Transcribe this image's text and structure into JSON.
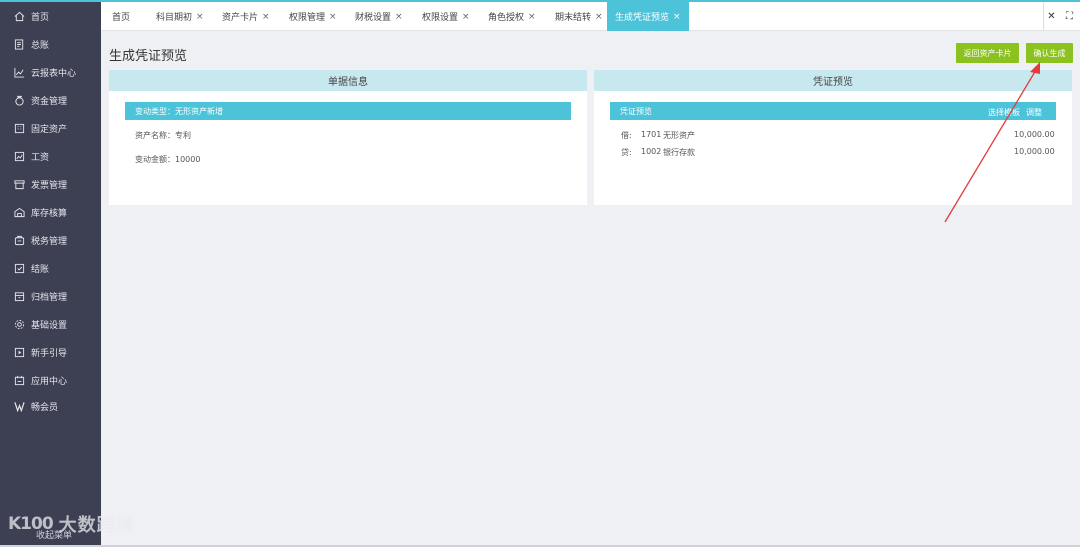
{
  "sidebar": {
    "items": [
      {
        "label": "首页",
        "icon": "home-icon"
      },
      {
        "label": "总账",
        "icon": "ledger-icon"
      },
      {
        "label": "云报表中心",
        "icon": "report-icon"
      },
      {
        "label": "资金管理",
        "icon": "money-bag-icon"
      },
      {
        "label": "固定资产",
        "icon": "building-icon"
      },
      {
        "label": "工资",
        "icon": "payroll-icon"
      },
      {
        "label": "发票管理",
        "icon": "invoice-icon"
      },
      {
        "label": "库存核算",
        "icon": "warehouse-icon"
      },
      {
        "label": "税务管理",
        "icon": "tax-icon"
      },
      {
        "label": "结账",
        "icon": "checkout-icon"
      },
      {
        "label": "归档管理",
        "icon": "archive-icon"
      },
      {
        "label": "基础设置",
        "icon": "gear-icon"
      },
      {
        "label": "新手引导",
        "icon": "play-guide-icon"
      },
      {
        "label": "应用中心",
        "icon": "app-center-icon"
      },
      {
        "label": "畅会员",
        "icon": "vip-icon"
      }
    ],
    "bottom_label": "收起菜单"
  },
  "watermark": {
    "logo": "K100",
    "text": "大数跨境"
  },
  "tabs": [
    {
      "label": "首页",
      "closable": false
    },
    {
      "label": "科目期初",
      "closable": true
    },
    {
      "label": "资产卡片",
      "closable": true
    },
    {
      "label": "权限管理",
      "closable": true
    },
    {
      "label": "财税设置",
      "closable": true
    },
    {
      "label": "权限设置",
      "closable": true
    },
    {
      "label": "角色授权",
      "closable": true
    },
    {
      "label": "期末结转",
      "closable": true
    },
    {
      "label": "生成凭证预览",
      "closable": true,
      "active": true
    }
  ],
  "tab_close_glyph": "×",
  "tabbar_controls": {
    "close_all": "✕",
    "fullscreen": "⛶"
  },
  "page": {
    "title": "生成凭证预览",
    "back_button": "返回资产卡片",
    "confirm_button": "确认生成"
  },
  "left_panel": {
    "header": "单据信息",
    "change_type": "变动类型：无形资产新增",
    "asset_name": "资产名称：专利",
    "change_amount": "变动金额：10000"
  },
  "right_panel": {
    "header": "凭证预览",
    "bar_label": "凭证预览",
    "select_template": "选择模板",
    "adjust": "调整",
    "entries": [
      {
        "direction": "借:",
        "code": "1701",
        "account": "无形资产",
        "amount": "10,000.00"
      },
      {
        "direction": "贷:",
        "code": "1002",
        "account": "银行存款",
        "amount": "10,000.00"
      }
    ]
  },
  "colors": {
    "sidebar_bg": "#3d3f52",
    "accent": "#4cc3d9",
    "panel_header": "#c8e8ef",
    "button_green": "#8cc21f",
    "annotation_arrow": "#e23b3b"
  }
}
